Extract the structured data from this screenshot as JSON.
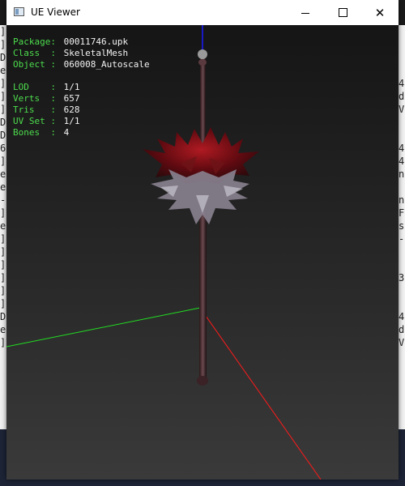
{
  "window": {
    "title": "UE Viewer",
    "minimize_glyph": "",
    "maximize_glyph": "",
    "close_glyph": "✕"
  },
  "info": {
    "package_label": "Package:",
    "package_value": "00011746.upk",
    "class_label": "Class  :",
    "class_value": "SkeletalMesh",
    "object_label": "Object :",
    "object_value": "060008_Autoscale",
    "lod_label": "LOD    :",
    "lod_value": "1/1",
    "verts_label": "Verts  :",
    "verts_value": "657",
    "tris_label": "Tris   :",
    "tris_value": "628",
    "uvset_label": "UV Set :",
    "uvset_value": "1/1",
    "bones_label": "Bones  :",
    "bones_value": "4"
  },
  "background_console": {
    "left": [
      "]",
      "]",
      "D",
      "e",
      "]",
      "]",
      "]",
      "D",
      "D",
      "6",
      "]",
      "e",
      "e",
      "-",
      "]",
      "e",
      "]",
      "]",
      "]",
      "]",
      "]",
      "]",
      "D",
      "e",
      "]"
    ],
    "right": [
      "",
      "",
      "",
      "",
      "4",
      "d",
      "V",
      "",
      "",
      "4",
      "4",
      "n",
      "",
      "n",
      "F",
      "s",
      "-",
      "",
      "",
      "3",
      "",
      "",
      "4",
      "d",
      "V"
    ]
  },
  "colors": {
    "axis_x": "#ff1a1a",
    "axis_y": "#22dd22",
    "axis_z": "#1a1aff",
    "label_green": "#4ddc4d"
  }
}
